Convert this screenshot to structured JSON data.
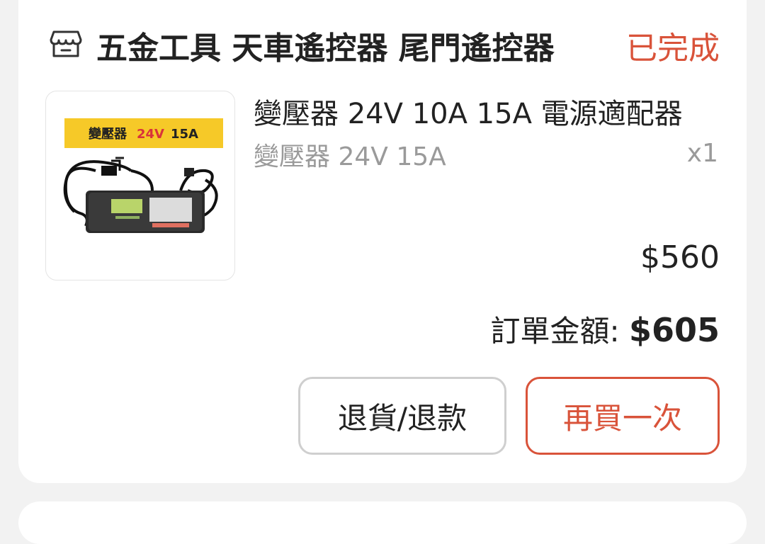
{
  "shop": {
    "icon": "store-icon",
    "name": "五金工具 天車遙控器 尾門遙控器",
    "status": "已完成"
  },
  "product": {
    "image_icon": "power-adapter-image",
    "image_banner": {
      "text_dark": "變壓器",
      "text_red": "24V",
      "text_dark2": "15A"
    },
    "title": "變壓器 24V 10A 15A 電源適配器",
    "variant": "變壓器 24V 15A",
    "quantity": "x1",
    "price": "$560"
  },
  "order": {
    "total_label": "訂單金額: ",
    "total_value": "$605"
  },
  "actions": {
    "return_label": "退貨/退款",
    "buy_again_label": "再買一次"
  },
  "colors": {
    "accent": "#d9533a",
    "banner_yellow": "#f6c928"
  }
}
